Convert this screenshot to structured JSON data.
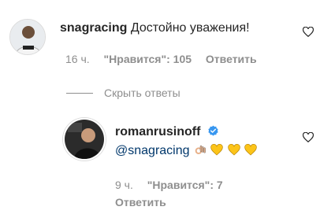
{
  "comment": {
    "username": "snagracing",
    "text": "Достойно уважения!",
    "time": "16 ч.",
    "likes": "\"Нравится\": 105",
    "reply_label": "Ответить"
  },
  "hide_replies_label": "Скрыть ответы",
  "reply": {
    "username": "romanrusinoff",
    "mention": "@snagracing",
    "emojis": [
      "ok-hand-emoji",
      "yellow-heart-emoji",
      "yellow-heart-emoji",
      "yellow-heart-emoji"
    ],
    "time": "9 ч.",
    "likes": "\"Нравится\": 7",
    "reply_label": "Ответить"
  },
  "colors": {
    "verified": "#3897f0",
    "meta": "#8e8e8e",
    "mention": "#00376b",
    "heart_emoji": "#fcc419"
  }
}
